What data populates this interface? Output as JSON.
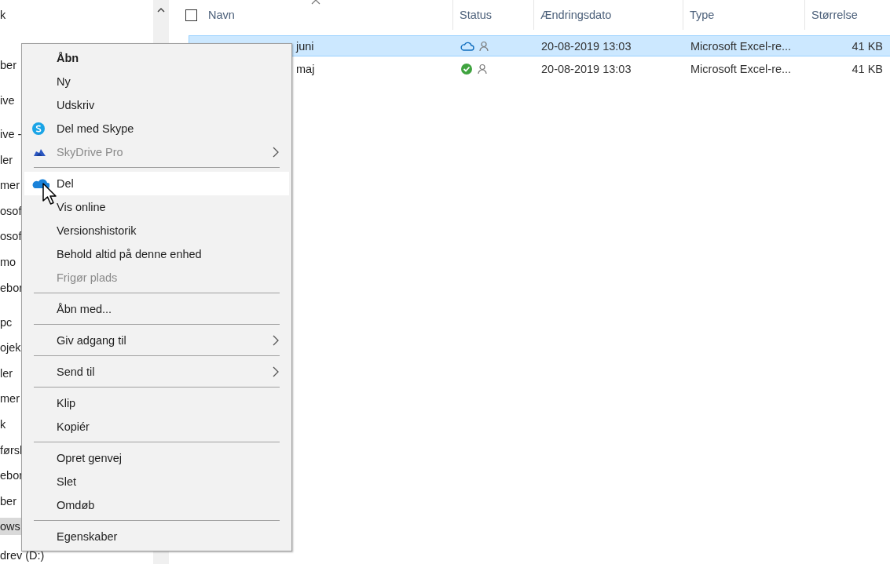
{
  "sidebar": {
    "items": [
      {
        "label": "k",
        "selected": false
      },
      {
        "label": "ber",
        "selected": false
      },
      {
        "label": "ive",
        "selected": false
      },
      {
        "label": "ive -",
        "selected": false
      },
      {
        "label": "ler",
        "selected": false
      },
      {
        "label": "mer",
        "selected": false
      },
      {
        "label": "osof",
        "selected": false
      },
      {
        "label": "osof",
        "selected": false
      },
      {
        "label": "mo",
        "selected": false
      },
      {
        "label": "ebor",
        "selected": false
      },
      {
        "label": "pc",
        "selected": false
      },
      {
        "label": "ojek",
        "selected": false
      },
      {
        "label": "ler",
        "selected": false
      },
      {
        "label": "mer",
        "selected": false
      },
      {
        "label": "k",
        "selected": false
      },
      {
        "label": "førsl",
        "selected": false
      },
      {
        "label": "ebor",
        "selected": false
      },
      {
        "label": "ber",
        "selected": false
      },
      {
        "label": "ows",
        "selected": true
      },
      {
        "label": "drev (D:)",
        "selected": false
      }
    ]
  },
  "file_list": {
    "select_all": {
      "checked": false
    },
    "columns": [
      {
        "label": "Navn",
        "sorted": true
      },
      {
        "label": "Status",
        "sorted": false
      },
      {
        "label": "Ændringsdato",
        "sorted": false
      },
      {
        "label": "Type",
        "sorted": false
      },
      {
        "label": "Størrelse",
        "sorted": false
      }
    ],
    "rows": [
      {
        "name": "juni",
        "selected": true,
        "available_offline": false,
        "modified": "20-08-2019 13:03",
        "type": "Microsoft Excel-re...",
        "size": "41 KB"
      },
      {
        "name": "maj",
        "selected": false,
        "available_offline": true,
        "modified": "20-08-2019 13:03",
        "type": "Microsoft Excel-re...",
        "size": "41 KB"
      }
    ]
  },
  "context_menu": {
    "items": [
      {
        "kind": "item",
        "label": "Åbn",
        "bold": true,
        "disabled": false,
        "hovered": false,
        "submenu": false
      },
      {
        "kind": "item",
        "label": "Ny",
        "bold": false,
        "disabled": false,
        "hovered": false,
        "submenu": false
      },
      {
        "kind": "item",
        "label": "Udskriv",
        "bold": false,
        "disabled": false,
        "hovered": false,
        "submenu": false
      },
      {
        "kind": "skype",
        "label": "Del med Skype",
        "bold": false,
        "disabled": false,
        "hovered": false,
        "submenu": false
      },
      {
        "kind": "skydrive",
        "label": "SkyDrive Pro",
        "bold": false,
        "disabled": true,
        "hovered": false,
        "submenu": true
      },
      {
        "kind": "separator"
      },
      {
        "kind": "onedrive",
        "label": "Del",
        "bold": false,
        "disabled": false,
        "hovered": true,
        "submenu": false
      },
      {
        "kind": "item",
        "label": "Vis online",
        "bold": false,
        "disabled": false,
        "hovered": false,
        "submenu": false
      },
      {
        "kind": "item",
        "label": "Versionshistorik",
        "bold": false,
        "disabled": false,
        "hovered": false,
        "submenu": false
      },
      {
        "kind": "item",
        "label": "Behold altid på denne enhed",
        "bold": false,
        "disabled": false,
        "hovered": false,
        "submenu": false
      },
      {
        "kind": "item",
        "label": "Frigør plads",
        "bold": false,
        "disabled": true,
        "hovered": false,
        "submenu": false
      },
      {
        "kind": "separator"
      },
      {
        "kind": "item",
        "label": "Åbn med...",
        "bold": false,
        "disabled": false,
        "hovered": false,
        "submenu": false
      },
      {
        "kind": "separator"
      },
      {
        "kind": "item",
        "label": "Giv adgang til",
        "bold": false,
        "disabled": false,
        "hovered": false,
        "submenu": true
      },
      {
        "kind": "separator"
      },
      {
        "kind": "item",
        "label": "Send til",
        "bold": false,
        "disabled": false,
        "hovered": false,
        "submenu": true
      },
      {
        "kind": "separator"
      },
      {
        "kind": "item",
        "label": "Klip",
        "bold": false,
        "disabled": false,
        "hovered": false,
        "submenu": false
      },
      {
        "kind": "item",
        "label": "Kopiér",
        "bold": false,
        "disabled": false,
        "hovered": false,
        "submenu": false
      },
      {
        "kind": "separator"
      },
      {
        "kind": "item",
        "label": "Opret genvej",
        "bold": false,
        "disabled": false,
        "hovered": false,
        "submenu": false
      },
      {
        "kind": "item",
        "label": "Slet",
        "bold": false,
        "disabled": false,
        "hovered": false,
        "submenu": false
      },
      {
        "kind": "item",
        "label": "Omdøb",
        "bold": false,
        "disabled": false,
        "hovered": false,
        "submenu": false
      },
      {
        "kind": "separator"
      },
      {
        "kind": "item",
        "label": "Egenskaber",
        "bold": false,
        "disabled": false,
        "hovered": false,
        "submenu": false
      }
    ]
  }
}
